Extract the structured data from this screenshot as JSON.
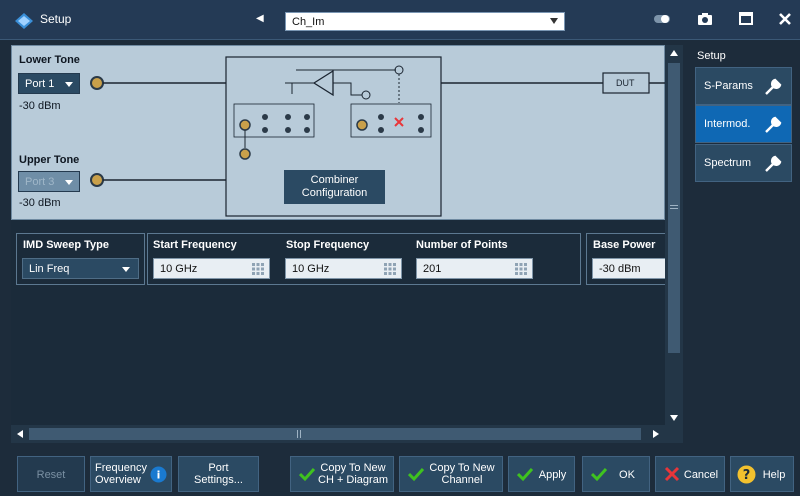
{
  "titlebar": {
    "title": "Setup",
    "channel_selected": "Ch_Im"
  },
  "diagram": {
    "lower_tone_label": "Lower Tone",
    "lower_tone_port": "Port 1",
    "lower_tone_power": "-30 dBm",
    "upper_tone_label": "Upper Tone",
    "upper_tone_port": "Port 3",
    "upper_tone_power": "-30 dBm",
    "dut_label": "DUT",
    "combiner_button_line1": "Combiner",
    "combiner_button_line2": "Configuration"
  },
  "params": {
    "sweep_type_header": "IMD Sweep Type",
    "sweep_type_value": "Lin Freq",
    "start_freq_header": "Start Frequency",
    "start_freq_value": "10 GHz",
    "stop_freq_header": "Stop Frequency",
    "stop_freq_value": "10 GHz",
    "points_header": "Number of Points",
    "points_value": "201",
    "base_power_header": "Base Power",
    "base_power_value": "-30 dBm"
  },
  "sidebar": {
    "label": "Setup",
    "items": [
      {
        "label": "S-Params"
      },
      {
        "label": "Intermod."
      },
      {
        "label": "Spectrum"
      }
    ]
  },
  "bottom": {
    "reset": "Reset",
    "freq_overview_1": "Frequency",
    "freq_overview_2": "Overview",
    "port_settings_1": "Port",
    "port_settings_2": "Settings...",
    "copy_ch_diag_1": "Copy To New",
    "copy_ch_diag_2": "CH + Diagram",
    "copy_ch_1": "Copy To New",
    "copy_ch_2": "Channel",
    "apply": "Apply",
    "ok": "OK",
    "cancel": "Cancel",
    "help": "Help"
  },
  "colors": {
    "accent": "#0f68b4",
    "check_green": "#3fc21f",
    "cancel_red": "#e8363a",
    "help_yellow": "#f2c12e"
  }
}
